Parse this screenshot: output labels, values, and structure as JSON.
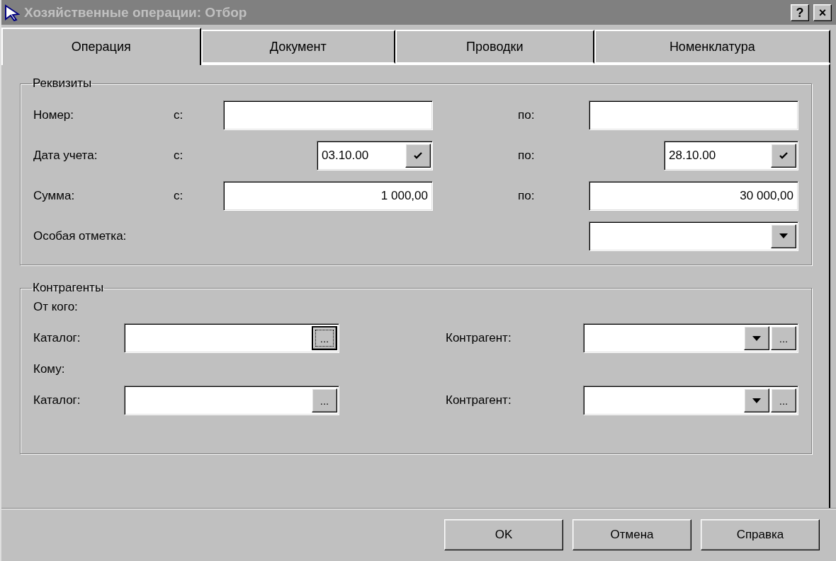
{
  "window": {
    "title": "Хозяйственные операции: Отбор",
    "controls": [
      "?",
      "×"
    ]
  },
  "tabs": [
    {
      "label": "Операция",
      "selected": true
    },
    {
      "label": "Документ",
      "selected": false
    },
    {
      "label": "Проводки",
      "selected": false
    },
    {
      "label": "Номенклатура",
      "selected": false
    }
  ],
  "requisites": {
    "title": "Реквизиты",
    "rows": [
      {
        "kind": "text",
        "label": "Номер:",
        "from_label": "с:",
        "to_label": "по:"
      },
      {
        "kind": "date",
        "label": "Дата учета:",
        "from_label": "с:",
        "from_value": "03.10.00",
        "to_label": "по:",
        "to_value": "28.10.00"
      },
      {
        "kind": "number",
        "label": "Сумма:",
        "from_label": "с:",
        "from_value": "1 000,00",
        "to_label": "по:",
        "to_value": "30 000,00"
      },
      {
        "kind": "select",
        "label": "Особая отметка:"
      }
    ]
  },
  "counterparties": {
    "title": "Контрагенты",
    "sections": [
      {
        "heading": "От кого:",
        "catalog_label": "Каталог:",
        "catalog_browse": "...",
        "catalog_browse_focused": true,
        "party_label": "Контрагент:",
        "party_browse": "..."
      },
      {
        "heading": "Кому:",
        "catalog_label": "Каталог:",
        "catalog_browse": "...",
        "catalog_browse_focused": false,
        "party_label": "Контрагент:",
        "party_browse": "..."
      }
    ]
  },
  "buttons": [
    {
      "label": "OK"
    },
    {
      "label": "Отмена"
    },
    {
      "label": "Справка"
    }
  ]
}
